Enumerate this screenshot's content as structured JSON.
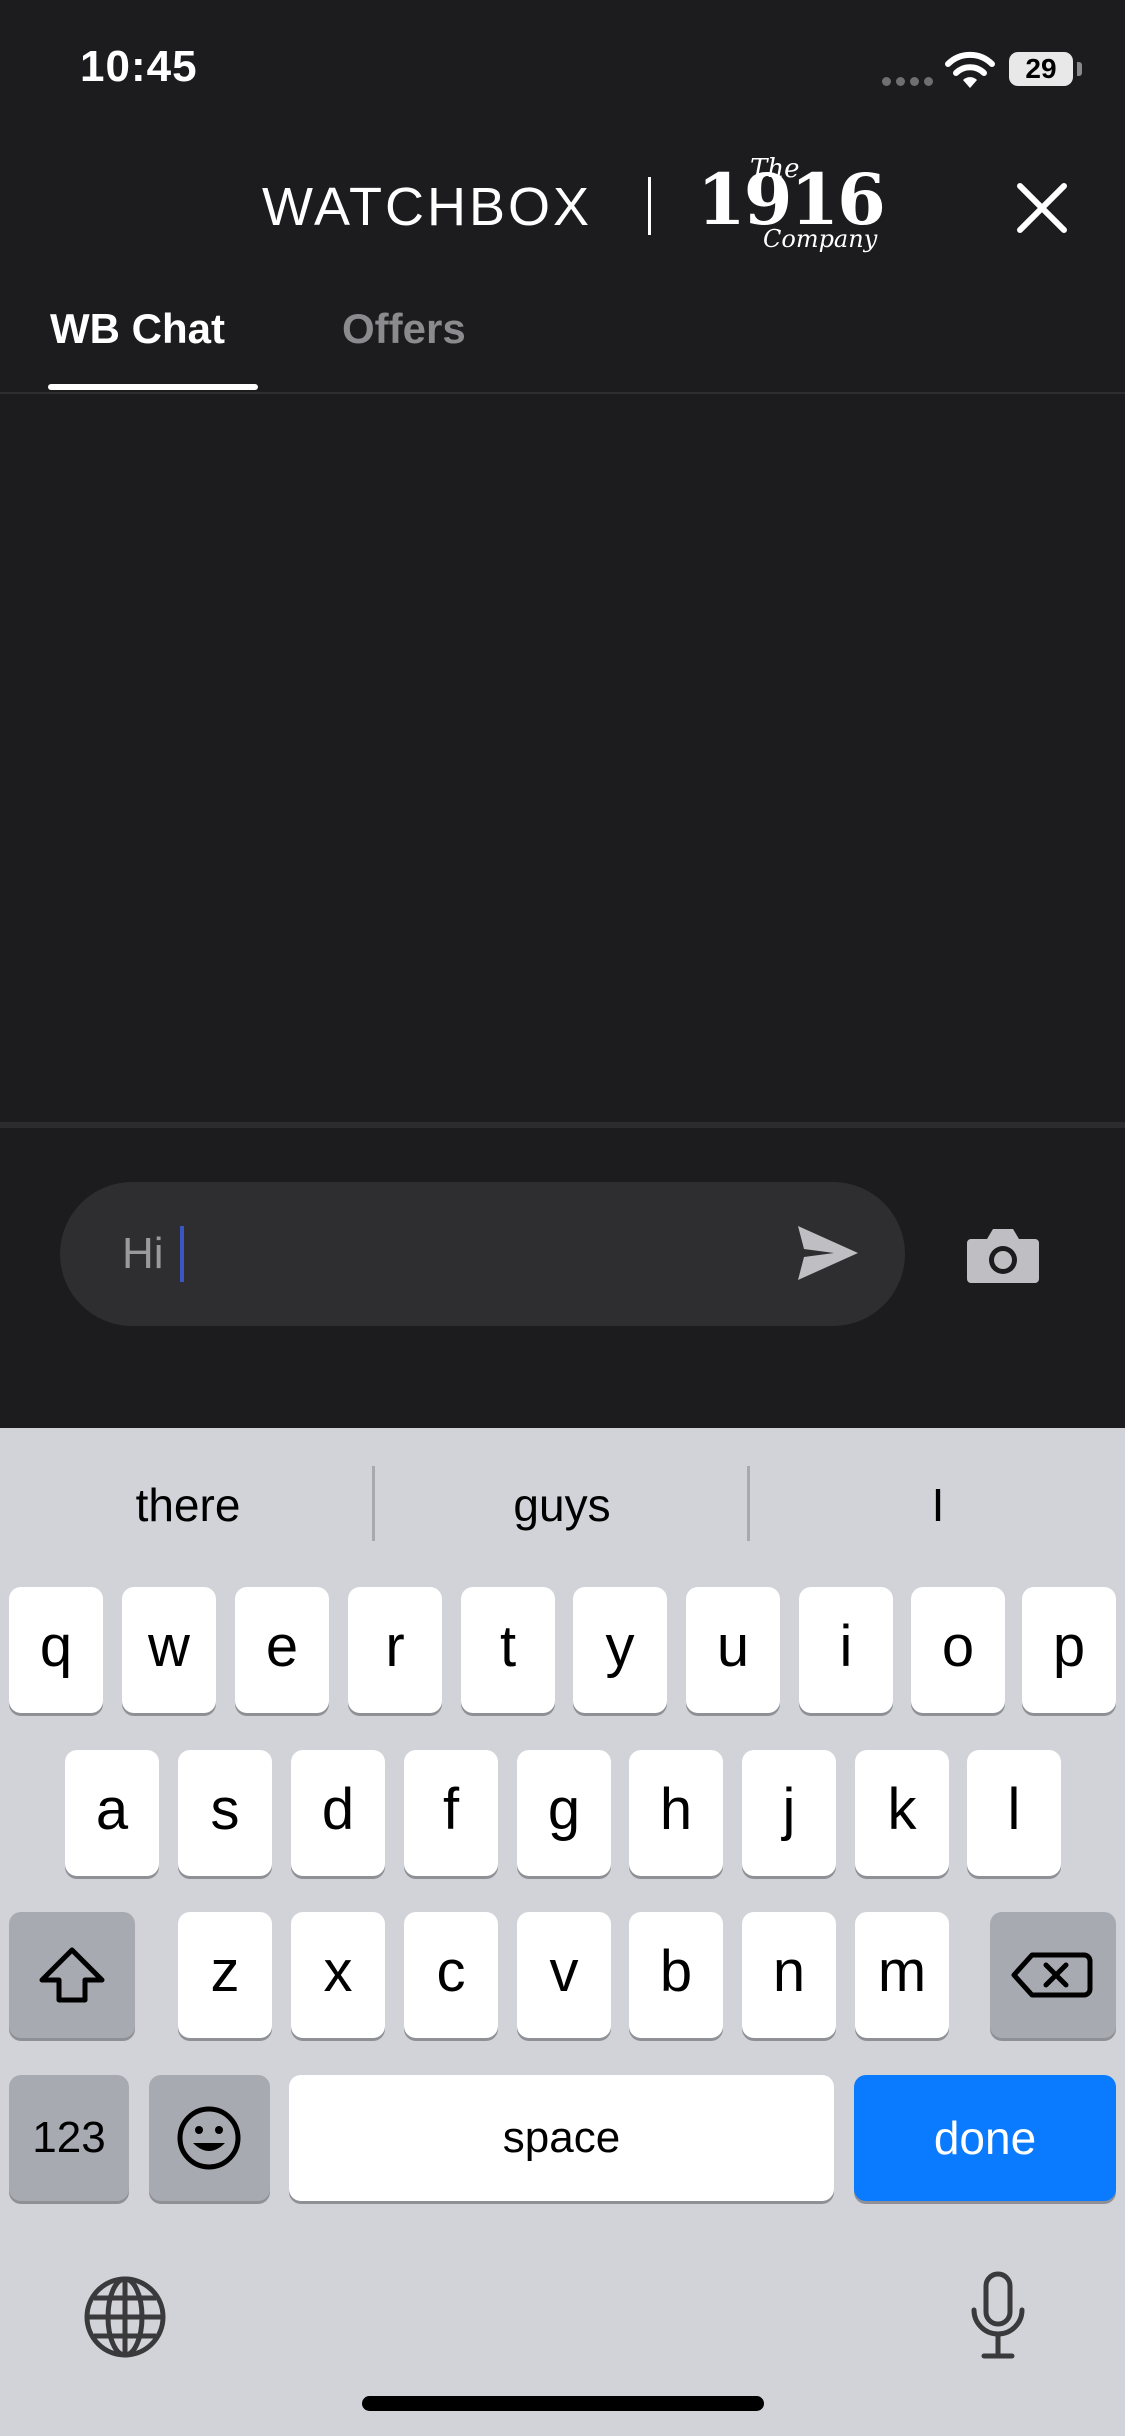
{
  "status_bar": {
    "time": "10:45",
    "battery": "29"
  },
  "header": {
    "brand_primary": "WATCHBOX",
    "brand_secondary_the": "The",
    "brand_secondary_number": "1916",
    "brand_secondary_company": "Company",
    "close_icon": "close-icon"
  },
  "tabs": [
    {
      "label": "WB Chat",
      "selected": true
    },
    {
      "label": "Offers",
      "selected": false
    }
  ],
  "composer": {
    "input_value": "Hi",
    "send_icon": "send-icon",
    "camera_icon": "camera-icon"
  },
  "keyboard": {
    "suggestions": [
      "there",
      "guys",
      "I"
    ],
    "row1": [
      "q",
      "w",
      "e",
      "r",
      "t",
      "y",
      "u",
      "i",
      "o",
      "p"
    ],
    "row2": [
      "a",
      "s",
      "d",
      "f",
      "g",
      "h",
      "j",
      "k",
      "l"
    ],
    "row3": [
      "z",
      "x",
      "c",
      "v",
      "b",
      "n",
      "m"
    ],
    "numbers_label": "123",
    "space_label": "space",
    "done_label": "done",
    "colors": {
      "done": "#0a7aff",
      "background": "#d1d3d9"
    }
  }
}
